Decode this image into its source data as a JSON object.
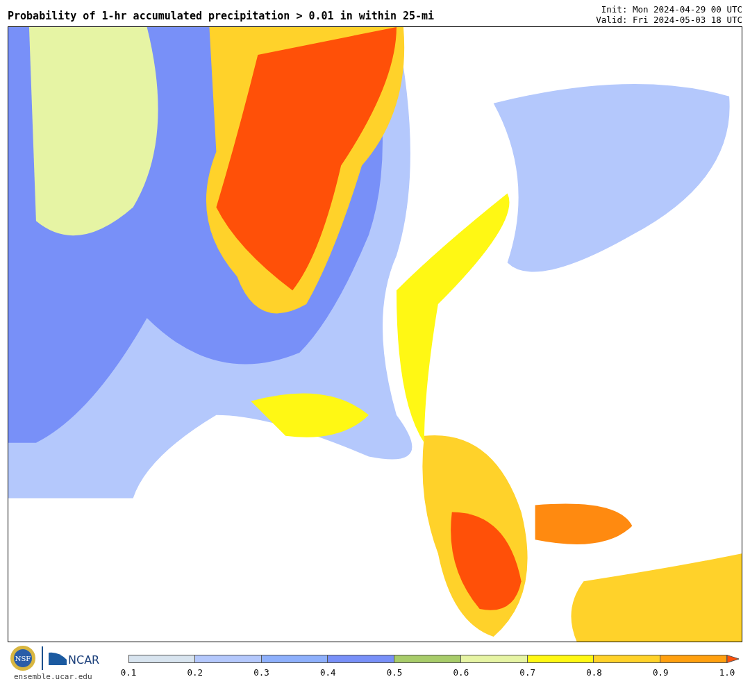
{
  "title": "Probability of 1-hr accumulated precipitation > 0.01 in within 25-mi",
  "init": "Init: Mon 2024-04-29 00 UTC",
  "valid": "Valid: Fri 2024-05-03 18 UTC",
  "logos": {
    "nsf": "NSF",
    "ncar": "NCAR",
    "site": "ensemble.ucar.edu"
  },
  "colorbar": {
    "bins": [
      {
        "color": "#d8e4ef"
      },
      {
        "color": "#b4c8fc"
      },
      {
        "color": "#8eb0fc"
      },
      {
        "color": "#7890f8"
      },
      {
        "color": "#a8cc6a"
      },
      {
        "color": "#e6f4a4"
      },
      {
        "color": "#fff814"
      },
      {
        "color": "#ffd22a"
      },
      {
        "color": "#ffa010"
      },
      {
        "kind": "arrow",
        "color": "#ff5008"
      }
    ],
    "ticks": [
      "0.1",
      "0.2",
      "0.3",
      "0.4",
      "0.5",
      "0.6",
      "0.7",
      "0.8",
      "0.9",
      "1.0"
    ]
  }
}
